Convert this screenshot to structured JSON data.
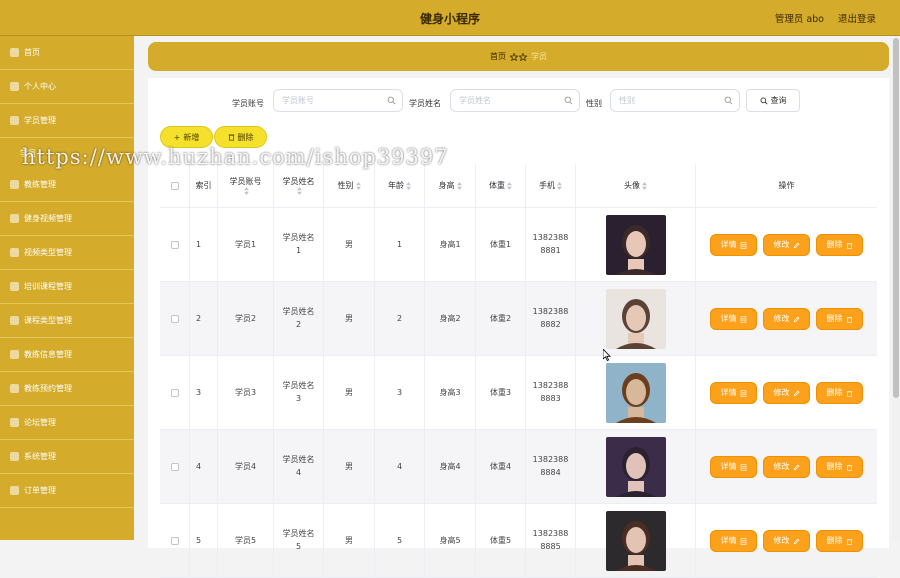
{
  "header": {
    "title": "健身小程序",
    "admin": "管理员 abo",
    "logout": "退出登录"
  },
  "sidebar": {
    "items": [
      {
        "label": "首页",
        "icon": "home-icon"
      },
      {
        "label": "个人中心",
        "icon": "user-icon"
      },
      {
        "label": "学员管理",
        "icon": "users-icon"
      },
      {
        "label": "教练管理",
        "icon": "coach-icon"
      },
      {
        "label": "健身视频管理",
        "icon": "video-icon"
      },
      {
        "label": "视频类型管理",
        "icon": "category-icon"
      },
      {
        "label": "培训课程管理",
        "icon": "course-icon"
      },
      {
        "label": "课程类型管理",
        "icon": "tag-icon"
      },
      {
        "label": "教练信息管理",
        "icon": "info-icon"
      },
      {
        "label": "教练预约管理",
        "icon": "calendar-icon"
      },
      {
        "label": "论坛管理",
        "icon": "forum-icon"
      },
      {
        "label": "系统管理",
        "icon": "settings-icon"
      },
      {
        "label": "订单管理",
        "icon": "order-icon"
      }
    ],
    "sub_item": "学员"
  },
  "breadcrumb": {
    "home": "首页",
    "current": "学员"
  },
  "search": {
    "fields": [
      {
        "label": "学员账号",
        "placeholder": "学员账号"
      },
      {
        "label": "学员姓名",
        "placeholder": "学员姓名"
      },
      {
        "label": "性别",
        "placeholder": "性别"
      }
    ],
    "query_label": "查询"
  },
  "actions": {
    "add_label": "新增",
    "delete_label": "删除"
  },
  "table": {
    "headers": [
      "索引",
      "学员账号",
      "学员姓名",
      "性别",
      "年龄",
      "身高",
      "体重",
      "手机",
      "头像",
      "操作"
    ],
    "rows": [
      {
        "index": "1",
        "account": "学员1",
        "name_line1": "学员姓名",
        "name_line2": "1",
        "gender": "男",
        "age": "1",
        "height": "身高1",
        "weight": "体重1",
        "phone_line1": "1382388",
        "phone_line2": "8881"
      },
      {
        "index": "2",
        "account": "学员2",
        "name_line1": "学员姓名",
        "name_line2": "2",
        "gender": "男",
        "age": "2",
        "height": "身高2",
        "weight": "体重2",
        "phone_line1": "1382388",
        "phone_line2": "8882"
      },
      {
        "index": "3",
        "account": "学员3",
        "name_line1": "学员姓名",
        "name_line2": "3",
        "gender": "男",
        "age": "3",
        "height": "身高3",
        "weight": "体重3",
        "phone_line1": "1382388",
        "phone_line2": "8883"
      },
      {
        "index": "4",
        "account": "学员4",
        "name_line1": "学员姓名",
        "name_line2": "4",
        "gender": "男",
        "age": "4",
        "height": "身高4",
        "weight": "体重4",
        "phone_line1": "1382388",
        "phone_line2": "8884"
      },
      {
        "index": "5",
        "account": "学员5",
        "name_line1": "学员姓名",
        "name_line2": "5",
        "gender": "男",
        "age": "5",
        "height": "身高5",
        "weight": "体重5",
        "phone_line1": "1382388",
        "phone_line2": "8885"
      }
    ],
    "op_labels": {
      "detail": "详情",
      "edit": "修改",
      "delete": "删除"
    }
  },
  "watermark": "https://www.huzhan.com/ishop39397",
  "colors": {
    "sidebar": "#d4ab2a",
    "accent_button": "#fba11b",
    "add_button": "#f5e12b"
  }
}
